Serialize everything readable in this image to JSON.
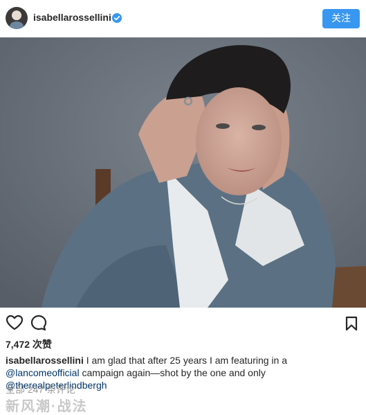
{
  "header": {
    "username": "isabellarossellini",
    "verified": true,
    "follow_label": "关注",
    "accent_color": "#3897f0"
  },
  "post": {
    "image_icon": "portrait-photo"
  },
  "actions": {
    "icons": [
      "heart-icon",
      "comment-icon",
      "bookmark-icon"
    ]
  },
  "stats": {
    "likes": "7,472 次赞"
  },
  "caption": {
    "username": "isabellarossellini",
    "text_1": " I am glad that after 25 years I am featuring in a ",
    "mention_1": "@lancomeofficial",
    "text_2": " campaign again—shot by the one and only ",
    "mention_2": "@therealpeterlindbergh",
    "mention_color": "#003569"
  },
  "comments": {
    "label": "全部 247 条评论"
  },
  "watermark": {
    "text": "新风潮·战法"
  }
}
